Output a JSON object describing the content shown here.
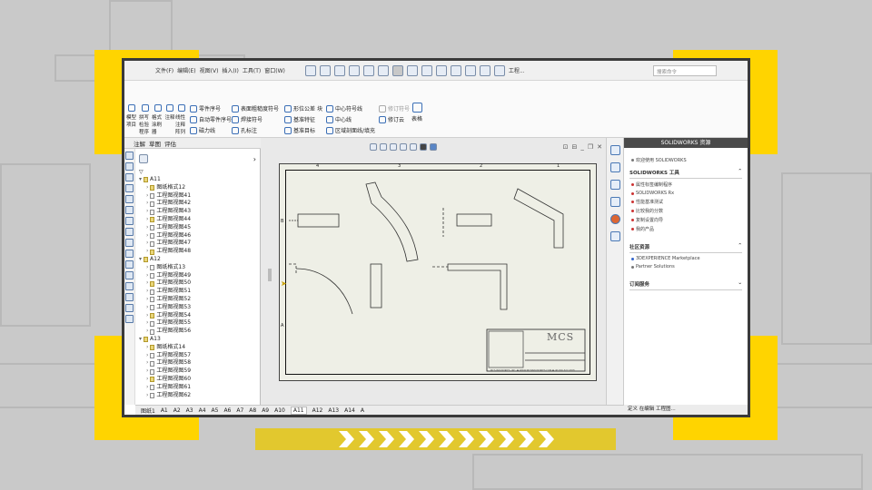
{
  "app": {
    "menu": [
      "文件(F)",
      "编辑(E)",
      "视图(V)",
      "插入(I)",
      "工具(T)",
      "窗口(W)"
    ],
    "toolbar_label": "工程...",
    "search_placeholder": "搜索命令",
    "brand_color": "#ffd400"
  },
  "ribbon": {
    "buttons": [
      {
        "label": "模型项目",
        "icon": "model-items-icon"
      },
      {
        "label": "拼写检验程序",
        "icon": "spell-check-icon"
      },
      {
        "label": "格式涂刷器",
        "icon": "format-painter-icon"
      },
      {
        "label": "注释",
        "icon": "note-icon"
      },
      {
        "label": "线性注释阵列",
        "icon": "linear-note-pattern-icon"
      },
      {
        "label": "零件序号",
        "icon": "balloon-icon"
      },
      {
        "label": "自动零件序号",
        "icon": "auto-balloon-icon"
      },
      {
        "label": "磁力线",
        "icon": "magnetic-line-icon"
      },
      {
        "label": "表面粗糙度符号",
        "icon": "surface-finish-icon"
      },
      {
        "label": "焊接符号",
        "icon": "weld-symbol-icon"
      },
      {
        "label": "孔标注",
        "icon": "hole-callout-icon"
      },
      {
        "label": "形位公差",
        "icon": "geometric-tolerance-icon"
      },
      {
        "label": "基准特征",
        "icon": "datum-feature-icon"
      },
      {
        "label": "基准目标",
        "icon": "datum-target-icon"
      },
      {
        "label": "块",
        "icon": "block-icon"
      },
      {
        "label": "中心符号线",
        "icon": "center-mark-icon"
      },
      {
        "label": "中心线",
        "icon": "centerline-icon"
      },
      {
        "label": "区域剖面线/填充",
        "icon": "hatch-icon"
      },
      {
        "label": "修订符号",
        "icon": "revision-symbol-icon"
      },
      {
        "label": "修订云",
        "icon": "revision-cloud-icon"
      },
      {
        "label": "表格",
        "icon": "table-icon"
      }
    ]
  },
  "panel_tabs": [
    "注解",
    "草图",
    "评估"
  ],
  "tree": [
    {
      "label": "A11",
      "level": 0
    },
    {
      "label": "图纸格式12",
      "level": 1
    },
    {
      "label": "工程图视图41",
      "level": 1
    },
    {
      "label": "工程图视图42",
      "level": 1
    },
    {
      "label": "工程图视图43",
      "level": 1
    },
    {
      "label": "工程图视图44",
      "level": 1
    },
    {
      "label": "工程图视图45",
      "level": 1
    },
    {
      "label": "工程图视图46",
      "level": 1
    },
    {
      "label": "工程图视图47",
      "level": 1
    },
    {
      "label": "工程图视图48",
      "level": 1
    },
    {
      "label": "A12",
      "level": 0
    },
    {
      "label": "图纸格式13",
      "level": 1
    },
    {
      "label": "工程图视图49",
      "level": 1
    },
    {
      "label": "工程图视图50",
      "level": 1
    },
    {
      "label": "工程图视图51",
      "level": 1
    },
    {
      "label": "工程图视图52",
      "level": 1
    },
    {
      "label": "工程图视图53",
      "level": 1
    },
    {
      "label": "工程图视图54",
      "level": 1
    },
    {
      "label": "工程图视图55",
      "level": 1
    },
    {
      "label": "工程图视图56",
      "level": 1
    },
    {
      "label": "A13",
      "level": 0
    },
    {
      "label": "图纸格式14",
      "level": 1
    },
    {
      "label": "工程图视图57",
      "level": 1
    },
    {
      "label": "工程图视图58",
      "level": 1
    },
    {
      "label": "工程图视图59",
      "level": 1
    },
    {
      "label": "工程图视图60",
      "level": 1
    },
    {
      "label": "工程图视图61",
      "level": 1
    },
    {
      "label": "工程图视图62",
      "level": 1
    }
  ],
  "sheet": {
    "column_numbers": [
      "4",
      "3",
      "2",
      "1"
    ],
    "row_letters": [
      "B",
      "A"
    ],
    "logo": "MCS",
    "footer": "MCS INDUSTRIES, INC. ● WWW.MCSINDUSTRIES.COM ● (P) 800.622.0658"
  },
  "sheet_tabs": [
    "图纸1",
    "A1",
    "A2",
    "A3",
    "A4",
    "A5",
    "A6",
    "A7",
    "A8",
    "A9",
    "A10",
    "A11",
    "A12",
    "A13",
    "A14",
    "A"
  ],
  "active_sheet_tab": "A11",
  "status_text": "定义  在编辑  工程图...",
  "task_pane": {
    "title": "SOLIDWORKS 资源",
    "welcome": "欢迎使用 SOLIDWORKS",
    "tools_title": "SOLIDWORKS 工具",
    "tools": [
      "属性标签编制程序",
      "SOLIDWORKS Rx",
      "性能基准测试",
      "比较我的分数",
      "复制设置向导",
      "我的产品"
    ],
    "community_title": "社区资源",
    "community": [
      "3DEXPERIENCE Marketplace",
      "Partner Solutions"
    ],
    "subscription_title": "订阅服务"
  }
}
